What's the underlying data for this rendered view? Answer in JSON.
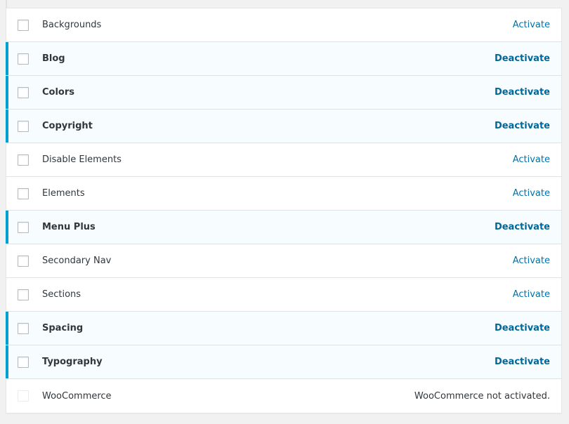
{
  "modules": [
    {
      "name": "Backgrounds",
      "active": false,
      "action": "Activate"
    },
    {
      "name": "Blog",
      "active": true,
      "action": "Deactivate"
    },
    {
      "name": "Colors",
      "active": true,
      "action": "Deactivate"
    },
    {
      "name": "Copyright",
      "active": true,
      "action": "Deactivate"
    },
    {
      "name": "Disable Elements",
      "active": false,
      "action": "Activate"
    },
    {
      "name": "Elements",
      "active": false,
      "action": "Activate"
    },
    {
      "name": "Menu Plus",
      "active": true,
      "action": "Deactivate"
    },
    {
      "name": "Secondary Nav",
      "active": false,
      "action": "Activate"
    },
    {
      "name": "Sections",
      "active": false,
      "action": "Activate"
    },
    {
      "name": "Spacing",
      "active": true,
      "action": "Deactivate"
    },
    {
      "name": "Typography",
      "active": true,
      "action": "Deactivate"
    },
    {
      "name": "WooCommerce",
      "active": false,
      "disabled": true,
      "status": "WooCommerce not activated."
    }
  ],
  "colors": {
    "active_border": "#00a0d2",
    "active_background": "#f7fcfe",
    "link": "#0073aa"
  }
}
